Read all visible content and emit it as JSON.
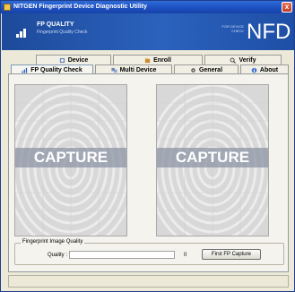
{
  "window": {
    "title": "NITGEN Fingerprint Device Diagnostic Utility",
    "close_glyph": "x"
  },
  "banner": {
    "title": "FP QUALITY",
    "subtitle": "Fingerprint Quality Check",
    "small_text": "FOR DEVICE CHECK",
    "logo": "NFD"
  },
  "tabs": {
    "row1": [
      {
        "label": "Device",
        "icon": "device-icon"
      },
      {
        "label": "Enroll",
        "icon": "enroll-icon"
      },
      {
        "label": "Verify",
        "icon": "verify-icon"
      }
    ],
    "row2": [
      {
        "label": "FP Quality Check",
        "icon": "quality-icon",
        "active": true
      },
      {
        "label": "Multi Device",
        "icon": "multi-device-icon"
      },
      {
        "label": "General",
        "icon": "general-icon"
      },
      {
        "label": "About",
        "icon": "about-icon"
      }
    ]
  },
  "captures": [
    {
      "label": "CAPTURE"
    },
    {
      "label": "CAPTURE"
    }
  ],
  "quality": {
    "group_title": "Fingerprint Image Quality",
    "label": "Quality :",
    "value": "0",
    "level": 0,
    "button_label": "First FP Capture"
  },
  "colors": {
    "title_bar": "#1d4fc0",
    "banner": "#2b62bd",
    "accent": "#3c6fd3"
  }
}
